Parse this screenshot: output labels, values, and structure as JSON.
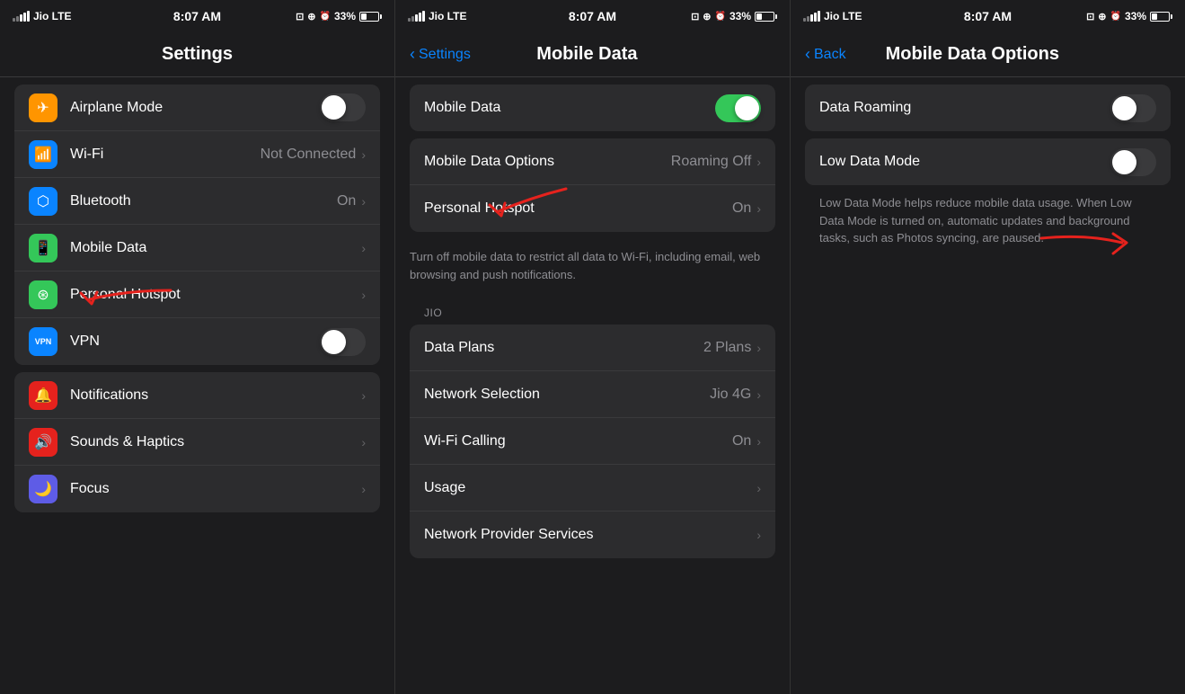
{
  "panels": [
    {
      "id": "settings-main",
      "statusBar": {
        "left": "Jio  LTE",
        "center": "8:07 AM",
        "rightIcons": [
          "car",
          "at",
          "alarm",
          "33%",
          "battery"
        ]
      },
      "navTitle": "Settings",
      "navBack": null,
      "sections": [
        {
          "items": [
            {
              "icon": "airplane",
              "iconBg": "#ff9500",
              "label": "Airplane Mode",
              "value": "",
              "type": "toggle",
              "toggleOn": false
            },
            {
              "icon": "wifi",
              "iconBg": "#0a84ff",
              "label": "Wi-Fi",
              "value": "Not Connected",
              "type": "nav"
            },
            {
              "icon": "bluetooth",
              "iconBg": "#0a84ff",
              "label": "Bluetooth",
              "value": "On",
              "type": "nav",
              "hasArrow": true
            },
            {
              "icon": "mobile",
              "iconBg": "#34c759",
              "label": "Mobile Data",
              "value": "",
              "type": "nav",
              "hasRedArrow": true
            },
            {
              "icon": "hotspot",
              "iconBg": "#34c759",
              "label": "Personal Hotspot",
              "value": "",
              "type": "nav"
            },
            {
              "icon": "vpn",
              "iconBg": "#0a84ff",
              "label": "VPN",
              "value": "",
              "type": "toggle",
              "toggleOn": false
            }
          ]
        },
        {
          "items": [
            {
              "icon": "notification",
              "iconBg": "#e5221d",
              "label": "Notifications",
              "value": "",
              "type": "nav"
            },
            {
              "icon": "sound",
              "iconBg": "#e5221d",
              "label": "Sounds & Haptics",
              "value": "",
              "type": "nav"
            },
            {
              "icon": "focus",
              "iconBg": "#5e5ce6",
              "label": "Focus",
              "value": "",
              "type": "nav"
            }
          ]
        }
      ]
    },
    {
      "id": "mobile-data",
      "statusBar": {
        "left": "Jio  LTE",
        "center": "8:07 AM",
        "rightIcons": [
          "car",
          "at",
          "alarm",
          "33%",
          "battery"
        ]
      },
      "navTitle": "Mobile Data",
      "navBack": "Settings",
      "sections": [
        {
          "items": [
            {
              "label": "Mobile Data",
              "value": "",
              "type": "toggle",
              "toggleOn": true
            }
          ]
        },
        {
          "items": [
            {
              "label": "Mobile Data Options",
              "value": "Roaming Off",
              "type": "nav",
              "hasRedArrow": true
            },
            {
              "label": "Personal Hotspot",
              "value": "On",
              "type": "nav"
            }
          ]
        },
        {
          "description": "Turn off mobile data to restrict all data to Wi-Fi, including email, web browsing and push notifications."
        },
        {
          "sectionLabel": "JIO",
          "items": [
            {
              "label": "Data Plans",
              "value": "2 Plans",
              "type": "nav"
            },
            {
              "label": "Network Selection",
              "value": "Jio 4G",
              "type": "nav"
            },
            {
              "label": "Wi-Fi Calling",
              "value": "On",
              "type": "nav"
            },
            {
              "label": "Usage",
              "value": "",
              "type": "nav"
            },
            {
              "label": "Network Provider Services",
              "value": "",
              "type": "nav"
            }
          ]
        }
      ]
    },
    {
      "id": "mobile-data-options",
      "statusBar": {
        "left": "Jio  LTE",
        "center": "8:07 AM",
        "rightIcons": [
          "car",
          "at",
          "alarm",
          "33%",
          "battery"
        ]
      },
      "navTitle": "Mobile Data Options",
      "navBack": "Back",
      "sections": [
        {
          "items": [
            {
              "label": "Data Roaming",
              "value": "",
              "type": "toggle",
              "toggleOn": false
            }
          ]
        },
        {
          "items": [
            {
              "label": "Low Data Mode",
              "value": "",
              "type": "toggle",
              "toggleOn": false,
              "hasRedArrow": true
            }
          ],
          "description": "Low Data Mode helps reduce mobile data usage. When Low Data Mode is turned on, automatic updates and background tasks, such as Photos syncing, are paused."
        }
      ]
    }
  ]
}
